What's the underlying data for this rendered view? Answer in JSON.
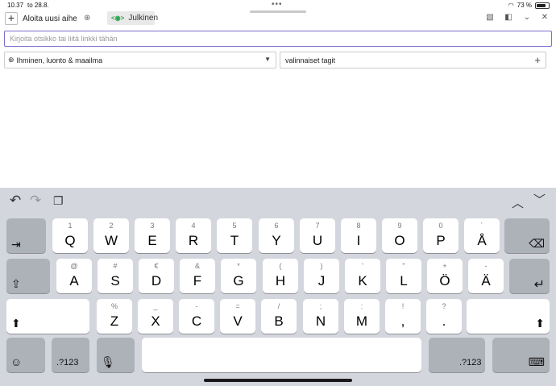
{
  "status_bar": {
    "time": "10.37",
    "date": "to 28.8.",
    "battery": "73 %",
    "wifi_icon": "wifi-icon",
    "battery_icon": "battery-icon"
  },
  "header": {
    "new_topic_label": "Aloita uusi aihe",
    "visibility_badge": "Julkinen",
    "visibility_icon": "eye-icon"
  },
  "form": {
    "title_placeholder": "Kirjoita otsikko tai liitä linkki tähän",
    "category": "Ihminen, luonto & maailma",
    "tags_placeholder": "valinnaiset tagit"
  },
  "keyboard": {
    "row1": [
      {
        "sub": "1",
        "main": "Q"
      },
      {
        "sub": "2",
        "main": "W"
      },
      {
        "sub": "3",
        "main": "E"
      },
      {
        "sub": "4",
        "main": "R"
      },
      {
        "sub": "5",
        "main": "T"
      },
      {
        "sub": "6",
        "main": "Y"
      },
      {
        "sub": "7",
        "main": "U"
      },
      {
        "sub": "8",
        "main": "I"
      },
      {
        "sub": "9",
        "main": "O"
      },
      {
        "sub": "0",
        "main": "P"
      },
      {
        "sub": "´",
        "main": "Å"
      }
    ],
    "row2": [
      {
        "sub": "@",
        "main": "A"
      },
      {
        "sub": "#",
        "main": "S"
      },
      {
        "sub": "€",
        "main": "D"
      },
      {
        "sub": "&",
        "main": "F"
      },
      {
        "sub": "*",
        "main": "G"
      },
      {
        "sub": "(",
        "main": "H"
      },
      {
        "sub": ")",
        "main": "J"
      },
      {
        "sub": "'",
        "main": "K"
      },
      {
        "sub": "\"",
        "main": "L"
      },
      {
        "sub": "+",
        "main": "Ö"
      },
      {
        "sub": "-",
        "main": "Ä"
      }
    ],
    "row3": [
      {
        "sub": "%",
        "main": "Z"
      },
      {
        "sub": "_",
        "main": "X"
      },
      {
        "sub": "-",
        "main": "C"
      },
      {
        "sub": "=",
        "main": "V"
      },
      {
        "sub": "/",
        "main": "B"
      },
      {
        "sub": ";",
        "main": "N"
      },
      {
        "sub": ":",
        "main": "M"
      },
      {
        "sub": "!",
        "main": ","
      },
      {
        "sub": "?",
        "main": "."
      }
    ],
    "numbers_label_left": ".?123",
    "numbers_label_right": ".?123"
  }
}
